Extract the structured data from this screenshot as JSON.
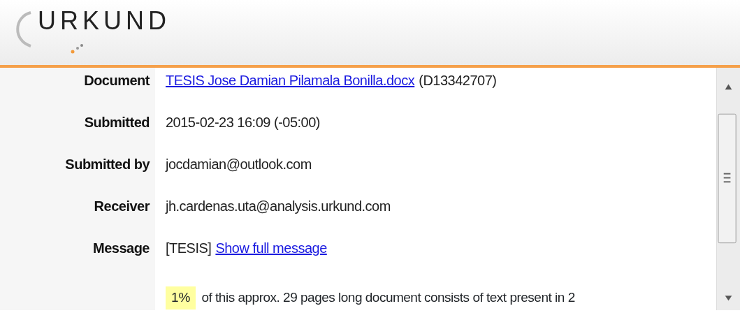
{
  "header": {
    "logo": "URKUND"
  },
  "fields": [
    {
      "label": "Document",
      "parts": [
        {
          "kind": "link",
          "text": "TESIS Jose Damian Pilamala Bonilla.docx"
        },
        {
          "kind": "text",
          "text": "(D13342707)"
        }
      ]
    },
    {
      "label": "Submitted",
      "parts": [
        {
          "kind": "text",
          "text": "2015-02-23 16:09 (-05:00)"
        }
      ]
    },
    {
      "label": "Submitted by",
      "parts": [
        {
          "kind": "text",
          "text": "jocdamian@outlook.com"
        }
      ]
    },
    {
      "label": "Receiver",
      "parts": [
        {
          "kind": "text",
          "text": "jh.cardenas.uta@analysis.urkund.com"
        }
      ]
    },
    {
      "label": "Message",
      "parts": [
        {
          "kind": "text",
          "text": "[TESIS]"
        },
        {
          "kind": "link",
          "text": "Show full message"
        }
      ]
    }
  ],
  "summary": {
    "percent": "1%",
    "text": "of this approx. 29 pages long document consists of text present in 2"
  }
}
